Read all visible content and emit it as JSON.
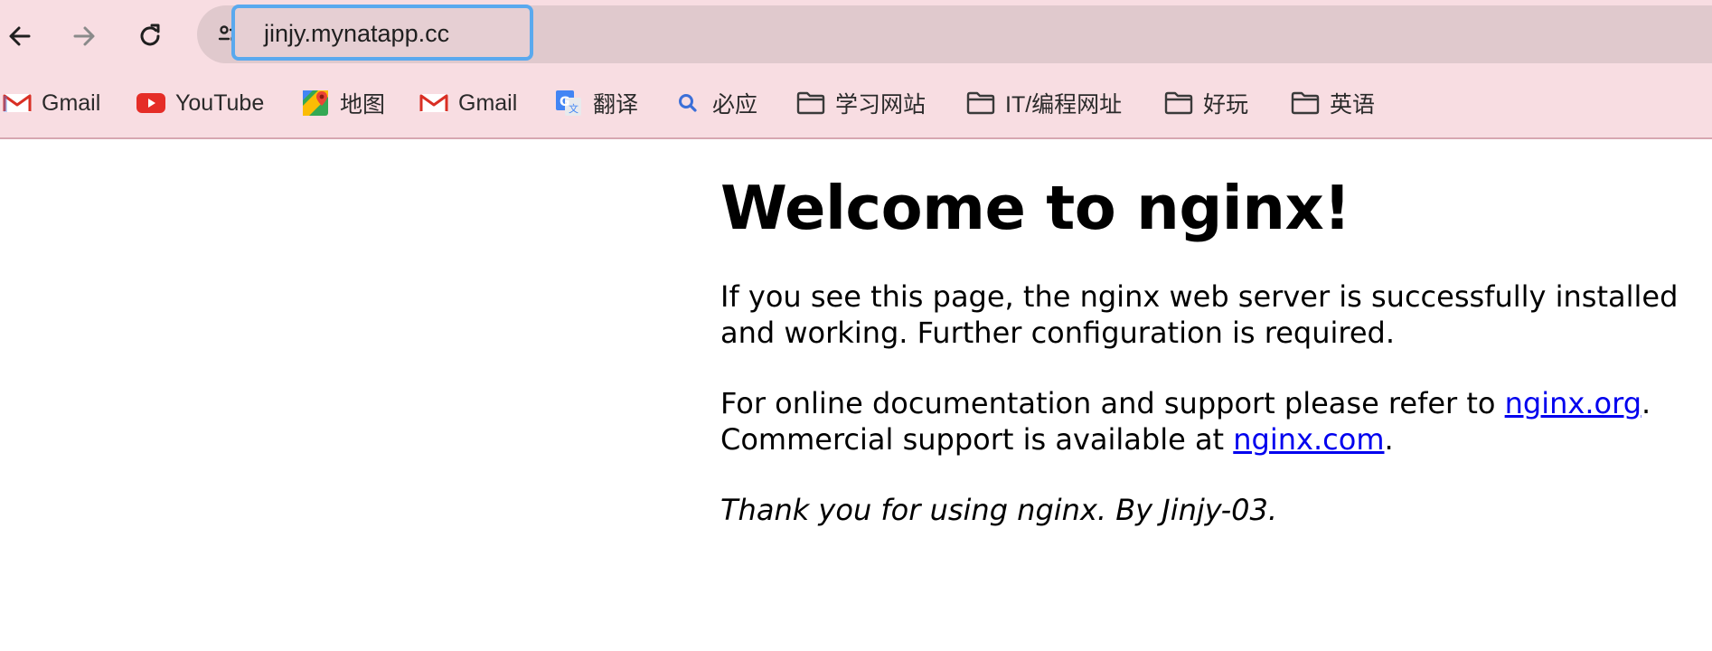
{
  "browser": {
    "url": "jinjy.mynatapp.cc",
    "nav": {
      "back": "back-arrow-icon",
      "forward": "forward-arrow-icon",
      "reload": "reload-icon"
    },
    "site_info_icon": "tune-icon"
  },
  "bookmarks": [
    {
      "label": "Gmail",
      "icon": "gmail-icon"
    },
    {
      "label": "YouTube",
      "icon": "youtube-icon"
    },
    {
      "label": "地图",
      "icon": "maps-icon"
    },
    {
      "label": "Gmail",
      "icon": "gmail-icon"
    },
    {
      "label": "翻译",
      "icon": "translate-icon"
    },
    {
      "label": "必应",
      "icon": "search-icon"
    },
    {
      "label": "学习网站",
      "icon": "folder-icon"
    },
    {
      "label": "IT/编程网址",
      "icon": "folder-icon"
    },
    {
      "label": "好玩",
      "icon": "folder-icon"
    },
    {
      "label": "英语",
      "icon": "folder-icon"
    }
  ],
  "page": {
    "heading": "Welcome to nginx!",
    "para1": "If you see this page, the nginx web server is successfully installed and working. Further configuration is required.",
    "para2_prefix": "For online documentation and support please refer to ",
    "link_org": "nginx.org",
    "para2_mid": ".",
    "para2_line2_prefix": "Commercial support is available at ",
    "link_com": "nginx.com",
    "para2_suffix": ".",
    "thanks": "Thank you for using nginx. By Jinjy-03."
  },
  "colors": {
    "toolbar_bg": "#f8dde2",
    "omnibox_bg": "#e0c9cd",
    "focus_ring": "#5aa9ee",
    "link": "#0000ee"
  }
}
